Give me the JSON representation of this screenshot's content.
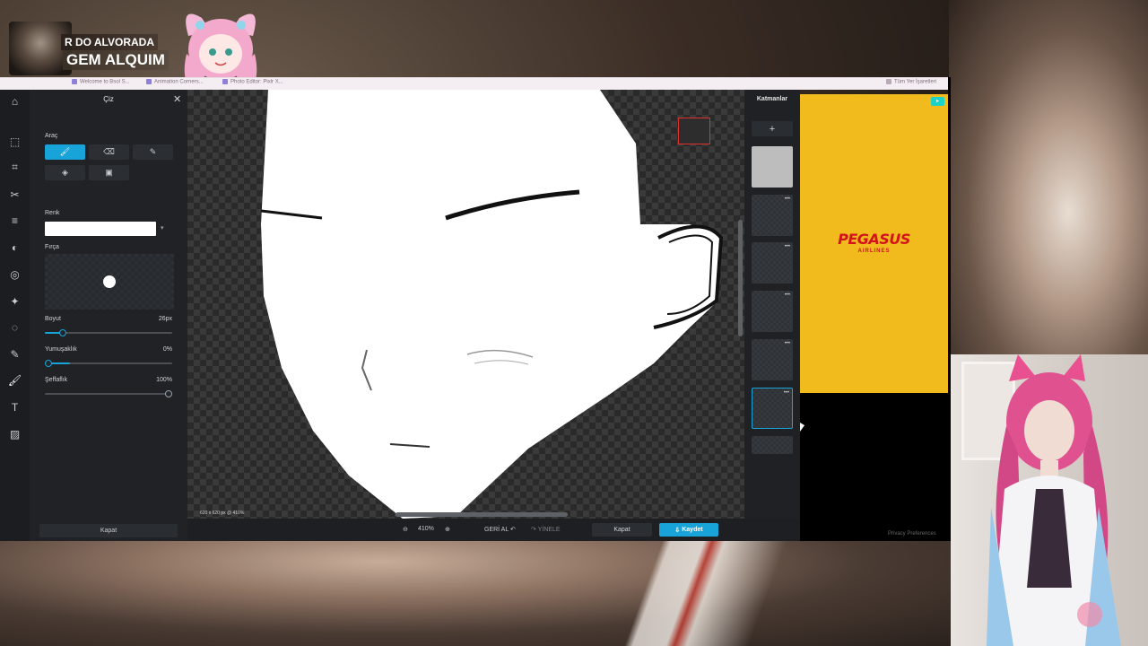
{
  "stream_overlay": {
    "line1": "R DO ALVORADA",
    "line2": "GEM ALQUIM"
  },
  "browser_bar": {
    "bookmarks": [
      "Welcome to Bsol S...",
      "Animation Corners...",
      "Photo Editor: Pixlr X...",
      "Tüm Yer İşaretleri"
    ]
  },
  "editor": {
    "panel_title": "Çiz",
    "tool_section_label": "Araç",
    "tools": [
      {
        "icon": "brush-icon",
        "glyph": "🖌"
      },
      {
        "icon": "eraser-icon",
        "glyph": "⌫"
      },
      {
        "icon": "pencil-icon",
        "glyph": "✎"
      },
      {
        "icon": "fill-bucket-icon",
        "glyph": "◈"
      },
      {
        "icon": "stamp-icon",
        "glyph": "▣"
      }
    ],
    "color_label": "Renk",
    "color_value": "#ffffff",
    "brush_label": "Fırça",
    "size_label": "Boyut",
    "size_value": "26px",
    "size_fraction": 0.14,
    "softness_label": "Yumuşaklık",
    "softness_value": "0%",
    "softness_fraction": 0.0,
    "opacity_label": "Şeffaflık",
    "opacity_value": "100%",
    "opacity_fraction": 1.0,
    "panel_close_label": "Kapat"
  },
  "rail_icons": [
    "home-icon",
    "arrange-icon",
    "crop-icon",
    "cutout-icon",
    "adjust-icon",
    "filter-icon",
    "effect-icon",
    "retouch-icon",
    "liquify-icon",
    "draw-icon",
    "brush-active-icon",
    "text-icon",
    "pattern-icon"
  ],
  "canvas": {
    "info": "620 x 620 px @ 410%"
  },
  "bottombar": {
    "zoom_value": "410%",
    "undo_label": "GERİ AL",
    "redo_label": "YİNELE",
    "close_label": "Kapat",
    "save_label": "Kaydet"
  },
  "layers": {
    "title": "Katmanlar",
    "add_glyph": "+",
    "count": 7
  },
  "ad": {
    "brand": "PEGASUS",
    "subtitle": "AIRLINES",
    "privacy": "Privacy Preferences"
  },
  "colors": {
    "accent": "#18a4d8",
    "ad_bg": "#f2bb1d",
    "ad_brand": "#d4121c"
  }
}
